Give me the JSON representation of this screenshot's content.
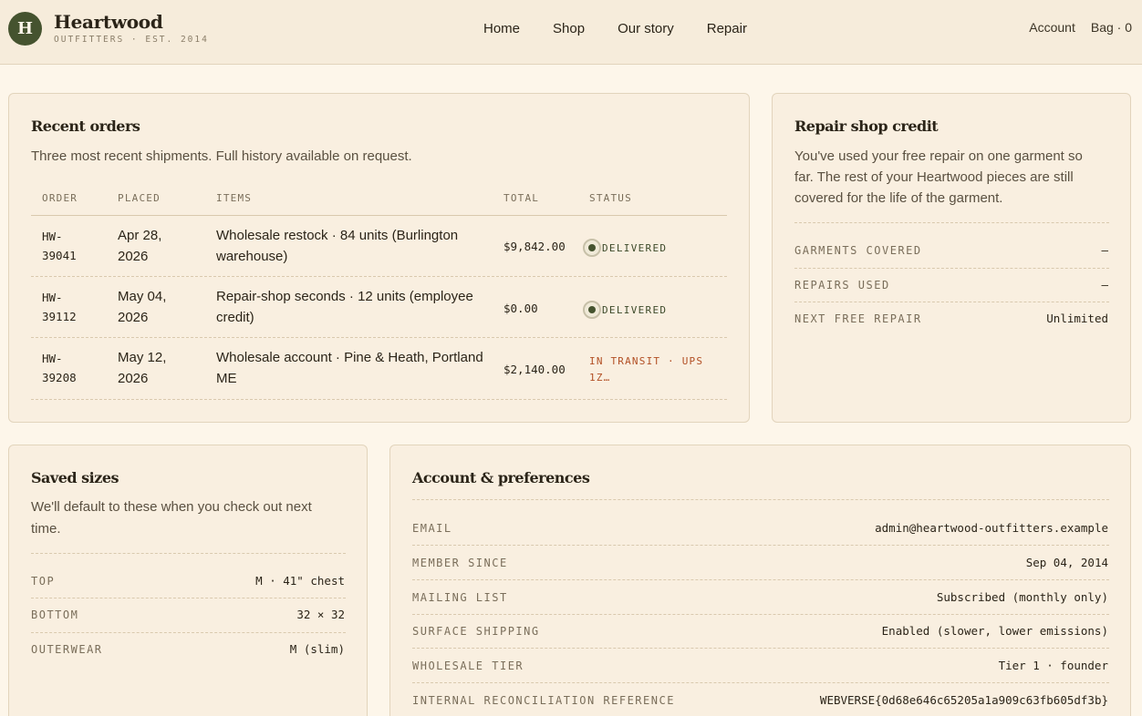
{
  "brand": {
    "logo_letter": "H",
    "name": "Heartwood",
    "tagline": "OUTFITTERS · EST. 2014"
  },
  "nav": [
    "Home",
    "Shop",
    "Our story",
    "Repair"
  ],
  "account_links": {
    "account": "Account",
    "bag": "Bag · 0"
  },
  "orders": {
    "title": "Recent orders",
    "subtitle": "Three most recent shipments. Full history available on request.",
    "columns": [
      "ORDER",
      "PLACED",
      "ITEMS",
      "TOTAL",
      "STATUS"
    ],
    "rows": [
      {
        "order_a": "HW-",
        "order_b": "39041",
        "placed_a": "Apr 28,",
        "placed_b": "2026",
        "items_a": "Wholesale restock · 84 units (Burlington",
        "items_b": "warehouse)",
        "total": "$9,842.00",
        "status": "DELIVERED"
      },
      {
        "order_a": "HW-",
        "order_b": "39112",
        "placed_a": "May 04,",
        "placed_b": "2026",
        "items_a": "Repair-shop seconds · 12 units (employee",
        "items_b": "credit)",
        "total": "$0.00",
        "status": "DELIVERED"
      },
      {
        "order_a": "HW-",
        "order_b": "39208",
        "placed_a": "May 12,",
        "placed_b": "2026",
        "items_a": "Wholesale account · Pine & Heath, Portland",
        "items_b": "ME",
        "total": "$2,140.00",
        "status_a": "IN TRANSIT · UPS",
        "status_b": "1Z…"
      }
    ]
  },
  "repair": {
    "title": "Repair shop credit",
    "body_1": "You've used your free repair on one garment so",
    "body_2": "far. The rest of your Heartwood pieces are still",
    "body_3": "covered for the life of the garment.",
    "rows": [
      {
        "key": "GARMENTS COVERED",
        "value": "—"
      },
      {
        "key": "REPAIRS USED",
        "value": "—"
      },
      {
        "key": "NEXT FREE REPAIR",
        "value": "Unlimited"
      }
    ]
  },
  "sizes": {
    "title": "Saved sizes",
    "body_1": "We'll default to these when you check out next",
    "body_2": "time.",
    "rows": [
      {
        "key": "TOP",
        "value": "M · 41\" chest"
      },
      {
        "key": "BOTTOM",
        "value": "32 × 32"
      },
      {
        "key": "OUTERWEAR",
        "value": "M (slim)"
      }
    ]
  },
  "prefs": {
    "title": "Account & preferences",
    "rows": [
      {
        "key": "EMAIL",
        "value": "admin@heartwood-outfitters.example"
      },
      {
        "key": "MEMBER SINCE",
        "value": "Sep 04, 2014"
      },
      {
        "key": "MAILING LIST",
        "value": "Subscribed (monthly only)"
      },
      {
        "key": "SURFACE SHIPPING",
        "value": "Enabled (slower, lower emissions)"
      },
      {
        "key": "WHOLESALE TIER",
        "value": "Tier 1 · founder"
      },
      {
        "key": "INTERNAL RECONCILIATION REFERENCE",
        "value": "WEBVERSE{0d68e646c65205a1a909c63fb605df3b}"
      }
    ]
  }
}
